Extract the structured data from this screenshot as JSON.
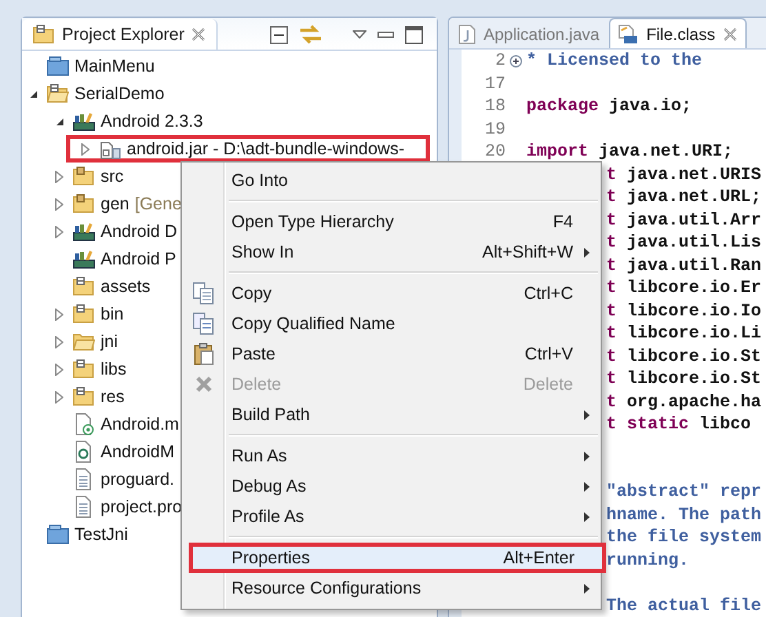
{
  "explorer": {
    "title": "Project Explorer",
    "tree": [
      {
        "label": "MainMenu",
        "kind": "closed-project",
        "annotated": false
      },
      {
        "label": "SerialDemo",
        "kind": "project",
        "expanded": true,
        "annotated": false,
        "children": [
          {
            "label": "Android 2.3.3",
            "kind": "library",
            "expanded": true,
            "annotated": false,
            "children": [
              {
                "label": "android.jar - D:\\adt-bundle-windows-",
                "kind": "jar",
                "expanded": false,
                "annotated": true
              }
            ]
          },
          {
            "label": "src",
            "kind": "source-folder",
            "expanded": false,
            "annotated": false
          },
          {
            "label": "gen",
            "decoration": "[Gene",
            "kind": "source-folder",
            "expanded": false,
            "annotated": false
          },
          {
            "label": "Android D",
            "kind": "library",
            "expanded": false,
            "annotated": false
          },
          {
            "label": "Android P",
            "kind": "library",
            "annotated": false
          },
          {
            "label": "assets",
            "kind": "folder",
            "annotated": false
          },
          {
            "label": "bin",
            "kind": "folder",
            "expanded": false,
            "annotated": false
          },
          {
            "label": "jni",
            "kind": "open-folder",
            "expanded": false,
            "annotated": false
          },
          {
            "label": "libs",
            "kind": "folder",
            "expanded": false,
            "annotated": false
          },
          {
            "label": "res",
            "kind": "folder",
            "expanded": false,
            "annotated": false
          },
          {
            "label": "Android.m",
            "kind": "makefile",
            "annotated": false
          },
          {
            "label": "AndroidM",
            "kind": "manifest",
            "annotated": false
          },
          {
            "label": "proguard.",
            "kind": "text-file",
            "annotated": false
          },
          {
            "label": "project.pro",
            "kind": "text-file",
            "annotated": false
          }
        ]
      },
      {
        "label": "TestJni",
        "kind": "closed-project",
        "annotated": false
      }
    ]
  },
  "editor": {
    "tabs": [
      {
        "label": "Application.java",
        "kind": "java",
        "selected": false
      },
      {
        "label": "File.class",
        "kind": "class",
        "selected": true
      }
    ],
    "lines": [
      {
        "number": "2",
        "fold": true,
        "covered": false,
        "segments": [
          {
            "kind": "comment",
            "text": " * Licensed to the"
          }
        ]
      },
      {
        "number": "17",
        "fold": false,
        "covered": false
      },
      {
        "number": "18",
        "fold": false,
        "covered": false,
        "segments": [
          {
            "kind": "keyword",
            "text": "package"
          },
          {
            "kind": "plain",
            "text": " java.io;"
          }
        ]
      },
      {
        "number": "19",
        "fold": false,
        "covered": false
      },
      {
        "number": "20",
        "fold": false,
        "covered": false,
        "segments": [
          {
            "kind": "keyword",
            "text": "import"
          },
          {
            "kind": "plain",
            "text": " java.net.URI;"
          }
        ]
      },
      {
        "fold": false,
        "covered": true,
        "segments": [
          {
            "kind": "keyword",
            "text": "t"
          },
          {
            "kind": "plain",
            "text": " java.net.URIS"
          }
        ]
      },
      {
        "fold": false,
        "covered": true,
        "segments": [
          {
            "kind": "keyword",
            "text": "t"
          },
          {
            "kind": "plain",
            "text": " java.net.URL;"
          }
        ]
      },
      {
        "fold": false,
        "covered": true,
        "segments": [
          {
            "kind": "keyword",
            "text": "t"
          },
          {
            "kind": "plain",
            "text": " java.util.Arr"
          }
        ]
      },
      {
        "fold": false,
        "covered": true,
        "segments": [
          {
            "kind": "keyword",
            "text": "t"
          },
          {
            "kind": "plain",
            "text": " java.util.Lis"
          }
        ]
      },
      {
        "fold": false,
        "covered": true,
        "segments": [
          {
            "kind": "keyword",
            "text": "t"
          },
          {
            "kind": "plain",
            "text": " java.util.Ran"
          }
        ]
      },
      {
        "fold": false,
        "covered": true,
        "segments": [
          {
            "kind": "keyword",
            "text": "t"
          },
          {
            "kind": "plain",
            "text": " libcore.io.Er"
          }
        ]
      },
      {
        "fold": false,
        "covered": true,
        "segments": [
          {
            "kind": "keyword",
            "text": "t"
          },
          {
            "kind": "plain",
            "text": " libcore.io.Io"
          }
        ]
      },
      {
        "fold": false,
        "covered": true,
        "segments": [
          {
            "kind": "keyword",
            "text": "t"
          },
          {
            "kind": "plain",
            "text": " libcore.io.Li"
          }
        ]
      },
      {
        "fold": false,
        "covered": true,
        "segments": [
          {
            "kind": "keyword",
            "text": "t"
          },
          {
            "kind": "plain",
            "text": " libcore.io.St"
          }
        ]
      },
      {
        "fold": false,
        "covered": true,
        "segments": [
          {
            "kind": "keyword",
            "text": "t"
          },
          {
            "kind": "plain",
            "text": " libcore.io.St"
          }
        ]
      },
      {
        "fold": false,
        "covered": true,
        "segments": [
          {
            "kind": "keyword",
            "text": "t"
          },
          {
            "kind": "plain",
            "text": " org.apache.ha"
          }
        ]
      },
      {
        "fold": false,
        "covered": true,
        "segments": [
          {
            "kind": "keyword",
            "text": "t static"
          },
          {
            "kind": "plain",
            "text": " libco"
          }
        ]
      },
      {
        "fold": false
      },
      {
        "fold": false
      },
      {
        "fold": false,
        "covered": true,
        "segments": [
          {
            "kind": "comment",
            "text": "\"abstract\" repr"
          }
        ]
      },
      {
        "fold": false,
        "covered": true,
        "segments": [
          {
            "kind": "comment",
            "text": "hname. The path"
          }
        ]
      },
      {
        "fold": false,
        "covered": true,
        "segments": [
          {
            "kind": "comment",
            "text": "the file system"
          }
        ]
      },
      {
        "fold": false,
        "covered": true,
        "segments": [
          {
            "kind": "comment",
            "text": "running."
          }
        ]
      },
      {
        "fold": false
      },
      {
        "fold": false,
        "covered": true,
        "segments": [
          {
            "kind": "comment",
            "text": "The actual file"
          }
        ]
      }
    ]
  },
  "context_menu": {
    "groups": [
      {
        "items": [
          {
            "kind": "plain",
            "label": "Go Into",
            "submenu": false,
            "disabled": false,
            "selected": false,
            "annotated": false
          }
        ]
      },
      {
        "items": [
          {
            "kind": "plain",
            "label": "Open Type Hierarchy",
            "shortcut": "F4",
            "submenu": false,
            "disabled": false,
            "selected": false,
            "annotated": false
          },
          {
            "kind": "plain",
            "label": "Show In",
            "shortcut": "Alt+Shift+W",
            "submenu": true,
            "disabled": false,
            "selected": false,
            "annotated": false
          }
        ]
      },
      {
        "items": [
          {
            "kind": "copy",
            "label": "Copy",
            "shortcut": "Ctrl+C",
            "submenu": false,
            "disabled": false,
            "selected": false,
            "annotated": false
          },
          {
            "kind": "copy-qualified",
            "label": "Copy Qualified Name",
            "submenu": false,
            "disabled": false,
            "selected": false,
            "annotated": false
          },
          {
            "kind": "paste",
            "label": "Paste",
            "shortcut": "Ctrl+V",
            "submenu": false,
            "disabled": false,
            "selected": false,
            "annotated": false
          },
          {
            "kind": "delete",
            "label": "Delete",
            "shortcut": "Delete",
            "submenu": false,
            "disabled": true,
            "selected": false,
            "annotated": false
          },
          {
            "kind": "plain",
            "label": "Build Path",
            "submenu": true,
            "disabled": false,
            "selected": false,
            "annotated": false
          }
        ]
      },
      {
        "items": [
          {
            "kind": "plain",
            "label": "Run As",
            "submenu": true,
            "disabled": false,
            "selected": false,
            "annotated": false
          },
          {
            "kind": "plain",
            "label": "Debug As",
            "submenu": true,
            "disabled": false,
            "selected": false,
            "annotated": false
          },
          {
            "kind": "plain",
            "label": "Profile As",
            "submenu": true,
            "disabled": false,
            "selected": false,
            "annotated": false
          }
        ]
      },
      {
        "items": [
          {
            "kind": "plain",
            "label": "Properties",
            "shortcut": "Alt+Enter",
            "submenu": false,
            "disabled": false,
            "selected": true,
            "annotated": true
          },
          {
            "kind": "plain",
            "label": "Resource Configurations",
            "submenu": true,
            "disabled": false,
            "selected": false,
            "annotated": false
          }
        ]
      }
    ]
  }
}
